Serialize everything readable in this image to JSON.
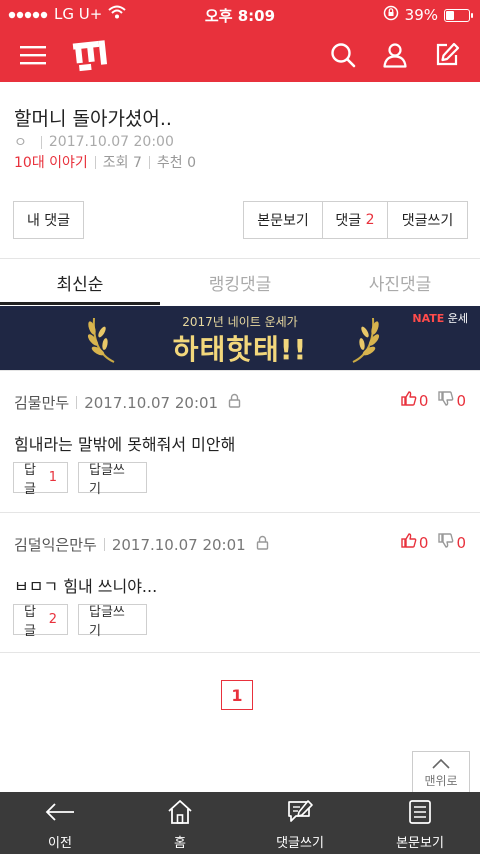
{
  "status_bar": {
    "carrier": "LG U+",
    "time": "오후 8:09",
    "battery": "39%",
    "battery_level": 0.39
  },
  "header": {
    "menu_icon": "hamburger-menu-icon",
    "logo_icon": "pann-logo-icon",
    "search_icon": "search-icon",
    "profile_icon": "user-icon",
    "write_icon": "write-icon",
    "accent_color": "#e8313c"
  },
  "post": {
    "title": "할머니 돌아가셨어..",
    "author": "ㅇ",
    "datetime": "2017.10.07 20:00",
    "category": "10대 이야기",
    "views": "조회 7",
    "recommends": "추천 0"
  },
  "comment_actions": {
    "my_comments": "내 댓글",
    "view_post": "본문보기",
    "comments_label": "댓글",
    "comments_count": "2",
    "write_comment": "댓글쓰기"
  },
  "tabs": [
    {
      "label": "최신순",
      "active": true
    },
    {
      "label": "랭킹댓글",
      "active": false
    },
    {
      "label": "사진댓글",
      "active": false
    }
  ],
  "banner": {
    "subtitle": "2017년 네이트 운세가",
    "headline": "하태핫태!!",
    "brand_prefix": "NATE",
    "brand_suffix": " 운세"
  },
  "comments": [
    {
      "author": "김물만두",
      "datetime": "2017.10.07 20:01",
      "text": "힘내라는 말밖에 못해줘서 미안해",
      "likes": "0",
      "dislikes": "0",
      "reply_label": "답글",
      "reply_count": "1",
      "write_reply": "답글쓰기"
    },
    {
      "author": "김덜익은만두",
      "datetime": "2017.10.07 20:01",
      "text": "ㅂㅁㄱ 힘내 쓰니야...",
      "likes": "0",
      "dislikes": "0",
      "reply_label": "답글",
      "reply_count": "2",
      "write_reply": "답글쓰기"
    }
  ],
  "pagination": {
    "current": "1"
  },
  "to_top": {
    "label": "맨위로"
  },
  "bottom_nav": [
    {
      "label": "이전",
      "icon": "back-arrow-icon"
    },
    {
      "label": "홈",
      "icon": "home-icon"
    },
    {
      "label": "댓글쓰기",
      "icon": "comment-write-icon"
    },
    {
      "label": "본문보기",
      "icon": "document-icon"
    }
  ]
}
